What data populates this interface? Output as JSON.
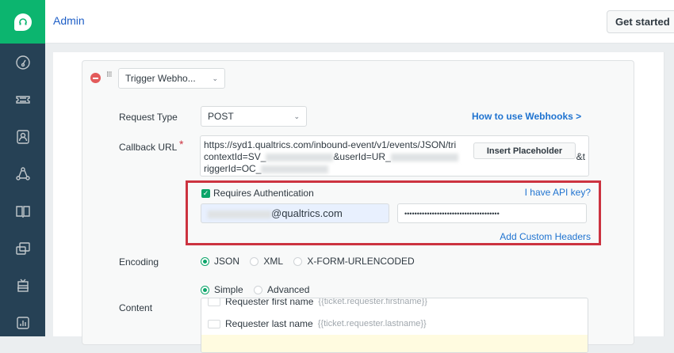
{
  "header": {
    "title": "Admin",
    "get_started": "Get started"
  },
  "action": {
    "select": "Trigger Webho..."
  },
  "form": {
    "request_type_label": "Request Type",
    "request_type": "POST",
    "help_link": "How to use Webhooks >",
    "callback_label": "Callback URL",
    "required": "*",
    "url_line1": "https://syd1.qualtrics.com/inbound-event/v1/events/JSON/tri",
    "url_line2a": "contextId=SV_",
    "url_line2b": "&userId=UR_",
    "url_line2c": "&t",
    "url_line3": "riggerId=OC_",
    "insert_placeholder": "Insert Placeholder",
    "requires_auth": "Requires Authentication",
    "api_key_link": "I have API key?",
    "username": "@qualtrics.com",
    "password": "••••••••••••••••••••••••••••••••••••••",
    "custom_headers": "Add Custom Headers",
    "encoding_label": "Encoding",
    "encodings": [
      "JSON",
      "XML",
      "X-FORM-URLENCODED"
    ],
    "content_label": "Content",
    "content_modes": [
      "Simple",
      "Advanced"
    ],
    "fields": [
      {
        "name": "Requester first name",
        "placeholder": "{{ticket.requester.firstname}}"
      },
      {
        "name": "Requester last name",
        "placeholder": "{{ticket.requester.lastname}}"
      }
    ]
  }
}
